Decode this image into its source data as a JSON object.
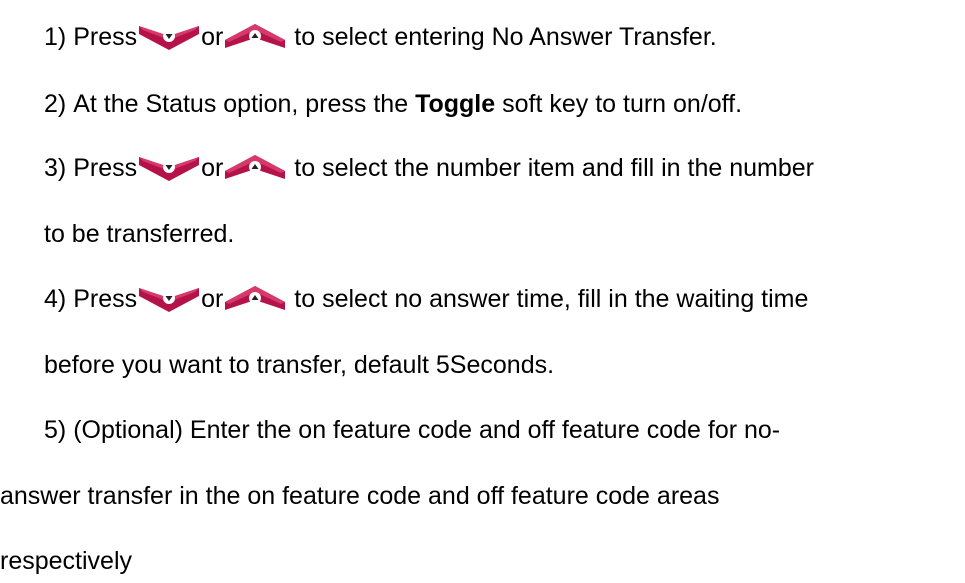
{
  "steps": [
    {
      "number": "1)",
      "pre": "Press",
      "or": "or",
      "post": "to select entering No Answer Transfer."
    },
    {
      "number": "2)",
      "pre": "At the Status option, press the",
      "bold": "Toggle",
      "post": "soft key to turn on/off."
    },
    {
      "number": "3)",
      "pre": "Press",
      "or": "or",
      "post": "to select the number item and fill in the number",
      "cont": "to be transferred."
    },
    {
      "number": "4)",
      "pre": "Press",
      "or": "or",
      "post": "to select no answer time, fill in the waiting time",
      "cont": "before you want to transfer, default 5Seconds."
    },
    {
      "number": "5)",
      "pre": "(Optional) Enter the on feature code and off feature code for no-",
      "cont": "answer transfer in the on feature code and off feature code areas",
      "cont2": "respectively"
    }
  ],
  "icons": {
    "down": "down-arrow-key-icon",
    "up": "up-arrow-key-icon"
  },
  "colors": {
    "key_fill": "#b5124a",
    "key_highlight": "#d63a6a",
    "arrow_bg": "#ffffff",
    "arrow": "#222222"
  }
}
